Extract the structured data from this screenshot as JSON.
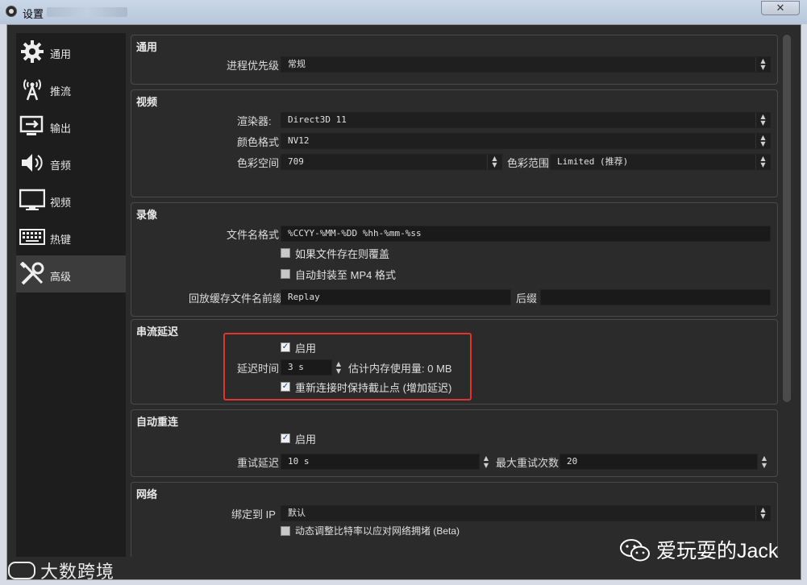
{
  "window": {
    "title": "设置",
    "close_glyph": "✕",
    "app_icon": "obs-icon"
  },
  "sidebar": {
    "items": [
      {
        "label": "通用",
        "icon": "gear-icon",
        "active": false
      },
      {
        "label": "推流",
        "icon": "broadcast-tower-icon",
        "active": false
      },
      {
        "label": "输出",
        "icon": "output-monitor-icon",
        "active": false
      },
      {
        "label": "音频",
        "icon": "speaker-icon",
        "active": false
      },
      {
        "label": "视频",
        "icon": "monitor-icon",
        "active": false
      },
      {
        "label": "热键",
        "icon": "keyboard-icon",
        "active": false
      },
      {
        "label": "高级",
        "icon": "tools-icon",
        "active": true
      }
    ]
  },
  "general": {
    "title": "通用",
    "priority_label": "进程优先级",
    "priority_value": "常规"
  },
  "video": {
    "title": "视频",
    "renderer_label": "渲染器:",
    "renderer_value": "Direct3D 11",
    "color_format_label": "颜色格式",
    "color_format_value": "NV12",
    "color_space_label": "色彩空间",
    "color_space_value": "709",
    "color_range_label": "色彩范围",
    "color_range_value": "Limited (推荐)"
  },
  "recording": {
    "title": "录像",
    "filename_format_label": "文件名格式",
    "filename_format_value": "%CCYY-%MM-%DD %hh-%mm-%ss",
    "overwrite_label": "如果文件存在则覆盖",
    "overwrite_checked": false,
    "automux_label": "自动封装至 MP4 格式",
    "automux_checked": false,
    "replay_prefix_label": "回放缓存文件名前缀",
    "replay_prefix_value": "Replay",
    "suffix_label": "后缀",
    "suffix_value": ""
  },
  "stream_delay": {
    "title": "串流延迟",
    "enable_label": "启用",
    "enable_checked": true,
    "delay_label": "延迟时间",
    "delay_value": "3 s",
    "memory_label": "估计内存使用量: 0 MB",
    "preserve_label": "重新连接时保持截止点 (增加延迟)",
    "preserve_checked": true
  },
  "reconnect": {
    "title": "自动重连",
    "enable_label": "启用",
    "enable_checked": true,
    "retry_delay_label": "重试延迟",
    "retry_delay_value": "10 s",
    "max_retries_label": "最大重试次数",
    "max_retries_value": "20"
  },
  "network": {
    "title": "网络",
    "bind_ip_label": "绑定到 IP",
    "bind_ip_value": "默认",
    "dynamic_bitrate_label": "动态调整比特率以应对网络拥堵 (Beta)"
  },
  "watermarks": {
    "left": "大数跨境",
    "right": "爱玩耍的Jack"
  },
  "colors": {
    "highlight": "#e0352f",
    "background": "#2b2b2b",
    "field": "#1a1a1a"
  }
}
